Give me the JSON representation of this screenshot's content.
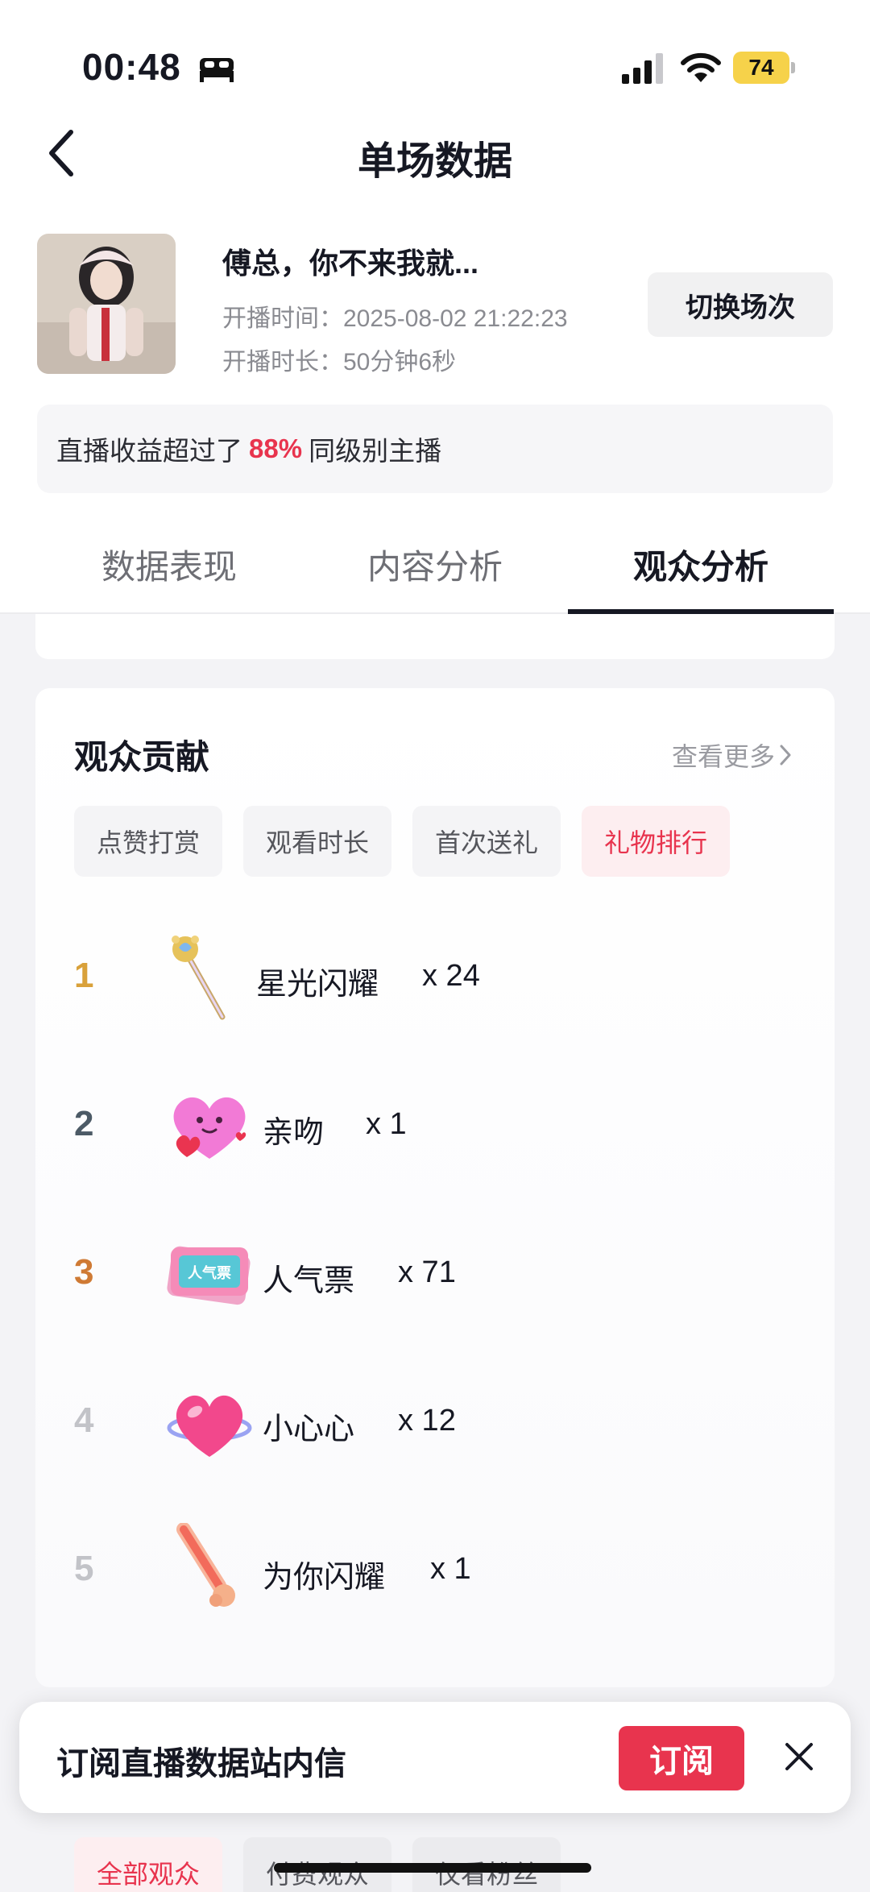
{
  "status_bar": {
    "time": "00:48",
    "battery": "74"
  },
  "nav": {
    "title": "单场数据"
  },
  "stream": {
    "title": "傅总，你不来我就...",
    "start_time": "开播时间：2025-08-02 21:22:23",
    "duration": "开播时长：50分钟6秒",
    "switch_label": "切换场次"
  },
  "rank_banner": {
    "prefix": "直播收益超过了",
    "percent": "88%",
    "suffix": "同级别主播"
  },
  "tabs": [
    {
      "label": "数据表现"
    },
    {
      "label": "内容分析"
    },
    {
      "label": "观众分析"
    }
  ],
  "audience": {
    "title": "观众贡献",
    "more": "查看更多",
    "chips": [
      {
        "label": "点赞打赏"
      },
      {
        "label": "观看时长"
      },
      {
        "label": "首次送礼"
      },
      {
        "label": "礼物排行"
      }
    ],
    "gifts": [
      {
        "rank": "1",
        "name": "星光闪耀",
        "count": "x 24",
        "icon": "scepter-icon",
        "rank_color": "#d9a13a"
      },
      {
        "rank": "2",
        "name": "亲吻",
        "count": "x 1",
        "icon": "heart-kiss-icon",
        "rank_color": "#4c5a66"
      },
      {
        "rank": "3",
        "name": "人气票",
        "count": "x 71",
        "icon": "ticket-icon",
        "rank_color": "#cf7a34"
      },
      {
        "rank": "4",
        "name": "小心心",
        "count": "x 12",
        "icon": "heart-icon",
        "rank_color": "#c2c3c8"
      },
      {
        "rank": "5",
        "name": "为你闪耀",
        "count": "x 1",
        "icon": "glowstick-icon",
        "rank_color": "#c2c3c8"
      }
    ]
  },
  "subscribe": {
    "text": "订阅直播数据站内信",
    "button": "订阅"
  },
  "bottom_chips": [
    {
      "label": "全部观众"
    },
    {
      "label": "付费观众"
    },
    {
      "label": "仅看粉丝"
    }
  ],
  "colors": {
    "accent": "#e8344e",
    "text": "#161823"
  }
}
